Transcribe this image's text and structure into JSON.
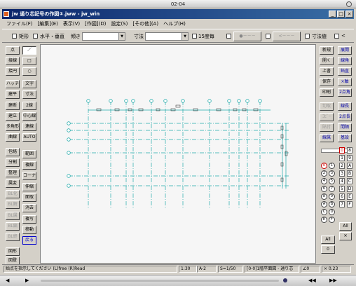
{
  "outer_title": "02-04",
  "window_title": "jw 通り芯記号の作図①.jww - jw_win",
  "window_buttons": {
    "min": "_",
    "max": "□",
    "close": "×"
  },
  "menu": [
    "ファイル(F)",
    "[編集](E)",
    "表示(V)",
    "[作図](D)",
    "設定(S)",
    "[その他](A)",
    "ヘルプ(H)"
  ],
  "toolbar": {
    "rect": "矩形",
    "hv": "水平・垂直",
    "angle": "傾き",
    "dim": "寸法",
    "scale15": "15度毎",
    "dot_label": "●－－－",
    "arrow_label": "<－－－",
    "dim_value": "寸法値",
    "lt": "<"
  },
  "left_tools": [
    [
      "点",
      "／"
    ],
    [
      "接線",
      "□"
    ],
    [
      "接円",
      "○"
    ],
    [
      "ハッチ",
      "文字"
    ],
    [
      "建平",
      "寸法"
    ],
    [
      "建断",
      "2線"
    ],
    [
      "建立",
      "中心線"
    ],
    [
      "多角形",
      "連線"
    ],
    [
      "曲線",
      "AUTO"
    ],
    [
      "包絡",
      "範囲"
    ],
    [
      "分割",
      "複線"
    ],
    [
      "整理",
      "コーナー"
    ],
    [
      "属変",
      "伸縮"
    ],
    [
      "BL化",
      "面取"
    ],
    [
      "BL解",
      "消去"
    ],
    [
      "BL属",
      "複写"
    ],
    [
      "BL編",
      "移動"
    ],
    [
      "BL終",
      "戻る"
    ],
    [
      "図形",
      ""
    ],
    [
      "図登",
      ""
    ]
  ],
  "right_tools": [
    [
      "新規",
      "展開"
    ],
    [
      "開く",
      "線角"
    ],
    [
      "上書",
      "鉛直"
    ],
    [
      "保存",
      "×軸"
    ],
    [
      "印刷",
      "2点角"
    ],
    [
      "切取",
      "線長"
    ],
    [
      "ｺﾋﾟｰ",
      "2点長"
    ],
    [
      "貼付",
      "間隔"
    ],
    [
      "線属",
      "基設"
    ]
  ],
  "layer_panel": {
    "nums": [
      "0",
      "1",
      "2",
      "3",
      "4",
      "5",
      "6",
      "7",
      "8",
      "9",
      "A",
      "B",
      "C",
      "D",
      "E",
      "F"
    ],
    "all": "All",
    "zero": "0"
  },
  "status": {
    "hint": "始点を指示してください (L)free (R)Read",
    "scale": "1:30",
    "paper": "A-2",
    "s": "S=1/50",
    "layer": "[0-0]1階平面図 - 通り芯",
    "angle": "∠0",
    "zoom": "× 0.23"
  }
}
